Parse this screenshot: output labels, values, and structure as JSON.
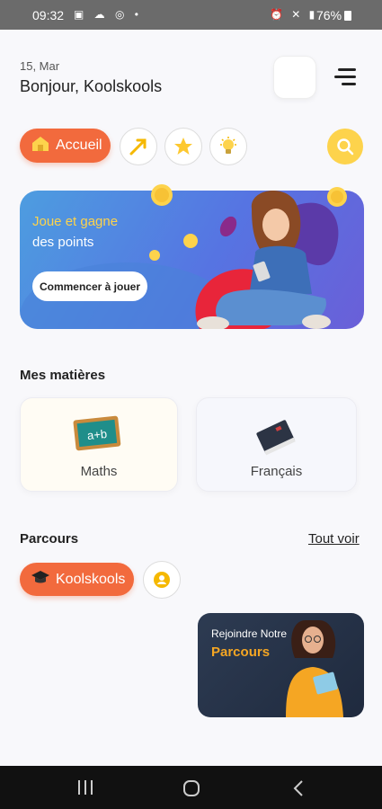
{
  "status_bar": {
    "time": "09:32",
    "battery": "76%"
  },
  "header": {
    "date": "15, Mar",
    "greeting": "Bonjour, Koolskools"
  },
  "nav": {
    "home_label": "Accueil"
  },
  "banner": {
    "title": "Joue et gagne",
    "subtitle": "des points",
    "button_label": "Commencer à jouer"
  },
  "subjects": {
    "title": "Mes matières",
    "items": [
      {
        "label": "Maths",
        "board_text": "a+b"
      },
      {
        "label": "Français"
      }
    ]
  },
  "parcours": {
    "title": "Parcours",
    "see_all": "Tout voir",
    "chip_label": "Koolskools",
    "promo_line1": "Rejoindre Notre",
    "promo_line2": "Parcours"
  },
  "colors": {
    "accent": "#f26a3d",
    "yellow": "#fdd34c",
    "banner_blue": "#5674e2"
  }
}
